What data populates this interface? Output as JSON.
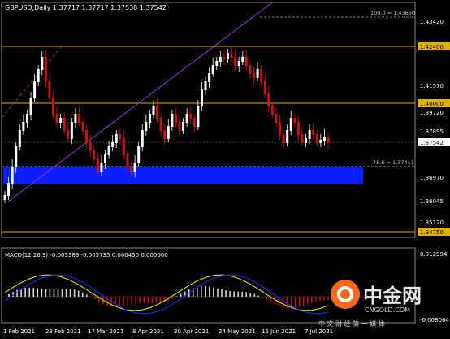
{
  "header": {
    "symbol_info": "GBPUSD,Daily  1.37717 1.37717 1.37538 1.37542"
  },
  "fib": {
    "top_label": "100.0 = 1.43650",
    "mid_label": "78.6 = 1.37411"
  },
  "price_axis": {
    "ticks": [
      "1.43420",
      "1.41570",
      "1.40000",
      "1.39720",
      "1.37895",
      "1.36970",
      "1.36045",
      "1.35120",
      "1.34750"
    ],
    "current_price": "1.37542",
    "highlighted": [
      "1.42400",
      "1.40000",
      "1.37542",
      "1.34750"
    ]
  },
  "levels": {
    "level_1": "1.42400",
    "level_2": "1.40000",
    "level_3": "1.34750"
  },
  "macd": {
    "label": "MACD(12,26,9) -0.005389 -0.005735 0.000450 0.000000",
    "axis_top": "0.012994",
    "axis_bottom": "-0.008064"
  },
  "date_axis": [
    "1 Feb 2021",
    "23 Feb 2021",
    "17 Mar 2021",
    "8 Apr 2021",
    "30 Apr 2021",
    "24 May 2021",
    "15 Jun 2021",
    "7 Jul 2021"
  ],
  "watermark": {
    "brand_cn": "中金网",
    "domain": "CNGOLD.COM",
    "slogan": "中 文 财 经 第 一 媒 体"
  },
  "colors": {
    "background": "#000000",
    "bull_candle": "#ffffff",
    "bear_candle": "#d01010",
    "level_line": "#e0b000",
    "support_zone": "#0a1eff",
    "channel_line": "#8a3ad8",
    "macd_signal": "#f0f000",
    "macd_main": "#1030d0"
  }
}
